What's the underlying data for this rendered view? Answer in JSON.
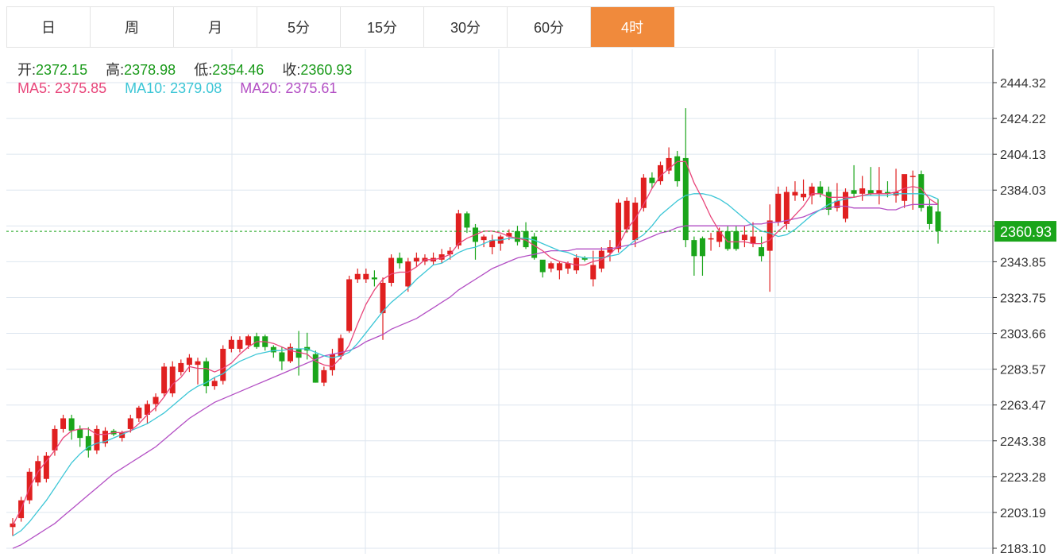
{
  "tabs": [
    {
      "label": "日",
      "active": false
    },
    {
      "label": "周",
      "active": false
    },
    {
      "label": "月",
      "active": false
    },
    {
      "label": "5分",
      "active": false
    },
    {
      "label": "15分",
      "active": false
    },
    {
      "label": "30分",
      "active": false
    },
    {
      "label": "60分",
      "active": false
    },
    {
      "label": "4时",
      "active": true
    }
  ],
  "ohlc": {
    "open_label": "开:",
    "open": "2372.15",
    "high_label": "高:",
    "high": "2378.98",
    "low_label": "低:",
    "low": "2354.46",
    "close_label": "收:",
    "close": "2360.93"
  },
  "ma": {
    "ma5_label": "MA5:",
    "ma5": "2375.85",
    "ma10_label": "MA10:",
    "ma10": "2379.08",
    "ma20_label": "MA20:",
    "ma20": "2375.61"
  },
  "colors": {
    "up": "#e02020",
    "down": "#1aa51a",
    "ma5": "#e8457a",
    "ma10": "#3cc6d6",
    "ma20": "#b34fc4",
    "grid": "#dde6ef",
    "last_price": "#1aa51a",
    "active_tab": "#f08a3c"
  },
  "chart_data": {
    "type": "candlestick",
    "y_ticks": [
      "2444.32",
      "2424.22",
      "2404.13",
      "2384.03",
      "2363.94",
      "2343.85",
      "2323.75",
      "2303.66",
      "2283.57",
      "2263.47",
      "2243.38",
      "2223.28",
      "2203.19",
      "2183.10"
    ],
    "ylim": [
      2183.1,
      2444.32
    ],
    "last_price": 2360.93,
    "last_price_label": "2360.93",
    "grid": true,
    "candles": [
      [
        2195,
        2200,
        2190,
        2197
      ],
      [
        2200,
        2212,
        2198,
        2210
      ],
      [
        2210,
        2228,
        2208,
        2226
      ],
      [
        2220,
        2235,
        2218,
        2232
      ],
      [
        2222,
        2237,
        2220,
        2235
      ],
      [
        2238,
        2252,
        2235,
        2250
      ],
      [
        2250,
        2258,
        2248,
        2256
      ],
      [
        2256,
        2258,
        2244,
        2249
      ],
      [
        2250,
        2252,
        2240,
        2245
      ],
      [
        2246,
        2251,
        2234,
        2238
      ],
      [
        2238,
        2252,
        2236,
        2250
      ],
      [
        2242,
        2251,
        2240,
        2249
      ],
      [
        2249,
        2250,
        2246,
        2247
      ],
      [
        2245,
        2249,
        2243,
        2248
      ],
      [
        2250,
        2258,
        2248,
        2256
      ],
      [
        2256,
        2263,
        2254,
        2262
      ],
      [
        2258,
        2266,
        2253,
        2264
      ],
      [
        2264,
        2270,
        2260,
        2268
      ],
      [
        2270,
        2287,
        2268,
        2285
      ],
      [
        2270,
        2288,
        2268,
        2285
      ],
      [
        2282,
        2289,
        2280,
        2287
      ],
      [
        2286,
        2292,
        2282,
        2290
      ],
      [
        2286,
        2290,
        2275,
        2288
      ],
      [
        2288,
        2290,
        2270,
        2274
      ],
      [
        2274,
        2279,
        2272,
        2277
      ],
      [
        2277,
        2297,
        2275,
        2295
      ],
      [
        2295,
        2302,
        2293,
        2300
      ],
      [
        2295,
        2302,
        2293,
        2300
      ],
      [
        2297,
        2303,
        2295,
        2302
      ],
      [
        2302,
        2304,
        2295,
        2296
      ],
      [
        2302,
        2303,
        2294,
        2296
      ],
      [
        2296,
        2297,
        2290,
        2293
      ],
      [
        2293,
        2296,
        2283,
        2288
      ],
      [
        2288,
        2298,
        2287,
        2296
      ],
      [
        2295,
        2305,
        2280,
        2290
      ],
      [
        2296,
        2304,
        2289,
        2294
      ],
      [
        2292,
        2294,
        2276,
        2276
      ],
      [
        2276,
        2285,
        2274,
        2283
      ],
      [
        2283,
        2295,
        2280,
        2292
      ],
      [
        2291,
        2303,
        2289,
        2301
      ],
      [
        2305,
        2336,
        2304,
        2334
      ],
      [
        2334,
        2340,
        2332,
        2337
      ],
      [
        2334,
        2340,
        2332,
        2337
      ],
      [
        2335,
        2339,
        2330,
        2334
      ],
      [
        2315,
        2335,
        2300,
        2332
      ],
      [
        2332,
        2348,
        2330,
        2346
      ],
      [
        2346,
        2349,
        2340,
        2343
      ],
      [
        2330,
        2346,
        2327,
        2344
      ],
      [
        2344,
        2349,
        2341,
        2346
      ],
      [
        2344,
        2348,
        2342,
        2346
      ],
      [
        2344,
        2349,
        2342,
        2346
      ],
      [
        2345,
        2351,
        2343,
        2348
      ],
      [
        2348,
        2352,
        2345,
        2350
      ],
      [
        2353,
        2373,
        2351,
        2371
      ],
      [
        2371,
        2372,
        2360,
        2363
      ],
      [
        2363,
        2365,
        2345,
        2355
      ],
      [
        2356,
        2359,
        2352,
        2358
      ],
      [
        2352,
        2359,
        2348,
        2356
      ],
      [
        2354,
        2359,
        2350,
        2358
      ],
      [
        2358,
        2362,
        2356,
        2360
      ],
      [
        2361,
        2364,
        2353,
        2355
      ],
      [
        2361,
        2366,
        2351,
        2352
      ],
      [
        2358,
        2360,
        2345,
        2346
      ],
      [
        2345,
        2338,
        2335,
        2338
      ],
      [
        2340,
        2344,
        2338,
        2343
      ],
      [
        2339,
        2344,
        2334,
        2343
      ],
      [
        2340,
        2344,
        2337,
        2343
      ],
      [
        2339,
        2348,
        2337,
        2346
      ],
      [
        2346,
        2347,
        2344,
        2345
      ],
      [
        2334,
        2350,
        2330,
        2342
      ],
      [
        2340,
        2352,
        2338,
        2350
      ],
      [
        2349,
        2356,
        2344,
        2352
      ],
      [
        2351,
        2379,
        2349,
        2377
      ],
      [
        2362,
        2380,
        2360,
        2378
      ],
      [
        2356,
        2380,
        2352,
        2377
      ],
      [
        2374,
        2393,
        2372,
        2391
      ],
      [
        2391,
        2394,
        2385,
        2388
      ],
      [
        2389,
        2400,
        2387,
        2398
      ],
      [
        2395,
        2408,
        2393,
        2402
      ],
      [
        2403,
        2406,
        2386,
        2389
      ],
      [
        2402,
        2430,
        2352,
        2356
      ],
      [
        2356,
        2358,
        2336,
        2347
      ],
      [
        2357,
        2358,
        2336,
        2347
      ],
      [
        2357,
        2360,
        2350,
        2357
      ],
      [
        2355,
        2363,
        2352,
        2361
      ],
      [
        2361,
        2364,
        2350,
        2351
      ],
      [
        2361,
        2364,
        2350,
        2351
      ],
      [
        2356,
        2364,
        2352,
        2359
      ],
      [
        2354,
        2366,
        2352,
        2358
      ],
      [
        2352,
        2358,
        2344,
        2347
      ],
      [
        2350,
        2376,
        2327,
        2367
      ],
      [
        2366,
        2386,
        2364,
        2382
      ],
      [
        2365,
        2386,
        2362,
        2383
      ],
      [
        2381,
        2389,
        2378,
        2383
      ],
      [
        2380,
        2390,
        2378,
        2382
      ],
      [
        2381,
        2388,
        2376,
        2386
      ],
      [
        2386,
        2389,
        2380,
        2382
      ],
      [
        2383,
        2386,
        2370,
        2373
      ],
      [
        2374,
        2388,
        2372,
        2378
      ],
      [
        2368,
        2385,
        2366,
        2383
      ],
      [
        2384,
        2398,
        2380,
        2382
      ],
      [
        2382,
        2392,
        2378,
        2385
      ],
      [
        2384,
        2397,
        2381,
        2382
      ],
      [
        2382,
        2397,
        2376,
        2384
      ],
      [
        2383,
        2389,
        2380,
        2382
      ],
      [
        2381,
        2396,
        2377,
        2383
      ],
      [
        2378,
        2392,
        2374,
        2393
      ],
      [
        2392,
        2395,
        2373,
        2392
      ],
      [
        2393,
        2395,
        2372,
        2374
      ],
      [
        2375,
        2379,
        2362,
        2365
      ],
      [
        2372,
        2379,
        2354,
        2361
      ]
    ],
    "ma5": [
      2196,
      2205,
      2217,
      2226,
      2232,
      2238,
      2245,
      2249,
      2250,
      2250,
      2247,
      2247,
      2248,
      2248,
      2249,
      2253,
      2258,
      2262,
      2268,
      2275,
      2279,
      2285,
      2284,
      2284,
      2282,
      2284,
      2287,
      2292,
      2296,
      2299,
      2299,
      2298,
      2296,
      2294,
      2293,
      2292,
      2288,
      2286,
      2285,
      2290,
      2297,
      2309,
      2320,
      2328,
      2334,
      2337,
      2338,
      2338,
      2341,
      2345,
      2345,
      2346,
      2348,
      2354,
      2357,
      2359,
      2361,
      2361,
      2360,
      2358,
      2357,
      2356,
      2353,
      2350,
      2346,
      2344,
      2343,
      2342,
      2342,
      2344,
      2345,
      2348,
      2353,
      2362,
      2368,
      2376,
      2385,
      2392,
      2396,
      2400,
      2400,
      2388,
      2379,
      2369,
      2361,
      2355,
      2355,
      2355,
      2354,
      2354,
      2356,
      2361,
      2365,
      2370,
      2375,
      2382,
      2382,
      2380,
      2380,
      2380,
      2380,
      2381,
      2382,
      2382,
      2382,
      2383,
      2385,
      2386,
      2385,
      2379,
      2376
    ],
    "ma10": [
      2190,
      2193,
      2198,
      2204,
      2210,
      2217,
      2224,
      2231,
      2236,
      2240,
      2242,
      2243,
      2245,
      2247,
      2249,
      2251,
      2253,
      2256,
      2259,
      2263,
      2267,
      2271,
      2274,
      2276,
      2279,
      2281,
      2285,
      2288,
      2290,
      2292,
      2293,
      2294,
      2294,
      2295,
      2295,
      2295,
      2293,
      2291,
      2290,
      2291,
      2293,
      2298,
      2304,
      2310,
      2316,
      2321,
      2325,
      2329,
      2334,
      2338,
      2342,
      2343,
      2346,
      2349,
      2351,
      2352,
      2354,
      2356,
      2356,
      2357,
      2357,
      2357,
      2356,
      2354,
      2352,
      2350,
      2349,
      2347,
      2346,
      2346,
      2346,
      2347,
      2348,
      2352,
      2356,
      2359,
      2364,
      2370,
      2374,
      2378,
      2381,
      2382,
      2382,
      2381,
      2379,
      2376,
      2372,
      2368,
      2364,
      2361,
      2360,
      2358,
      2359,
      2362,
      2366,
      2370,
      2373,
      2376,
      2378,
      2379,
      2380,
      2381,
      2381,
      2381,
      2381,
      2382,
      2382,
      2382,
      2382,
      2381,
      2379
    ],
    "ma20": [
      2183,
      2185,
      2188,
      2191,
      2194,
      2197,
      2201,
      2205,
      2209,
      2213,
      2217,
      2221,
      2225,
      2228,
      2231,
      2234,
      2237,
      2240,
      2244,
      2248,
      2252,
      2256,
      2259,
      2262,
      2265,
      2267,
      2269,
      2271,
      2273,
      2275,
      2277,
      2279,
      2281,
      2283,
      2285,
      2287,
      2289,
      2291,
      2292,
      2293,
      2294,
      2296,
      2299,
      2301,
      2303,
      2306,
      2308,
      2310,
      2312,
      2315,
      2318,
      2321,
      2324,
      2328,
      2331,
      2334,
      2337,
      2340,
      2342,
      2344,
      2346,
      2347,
      2348,
      2349,
      2350,
      2350,
      2350,
      2351,
      2351,
      2351,
      2351,
      2351,
      2352,
      2353,
      2354,
      2356,
      2358,
      2360,
      2361,
      2363,
      2364,
      2364,
      2364,
      2364,
      2364,
      2364,
      2364,
      2364,
      2365,
      2365,
      2366,
      2366,
      2367,
      2368,
      2369,
      2371,
      2373,
      2374,
      2375,
      2375,
      2374,
      2374,
      2374,
      2374,
      2373,
      2373,
      2375,
      2376,
      2376,
      2376,
      2376
    ]
  }
}
